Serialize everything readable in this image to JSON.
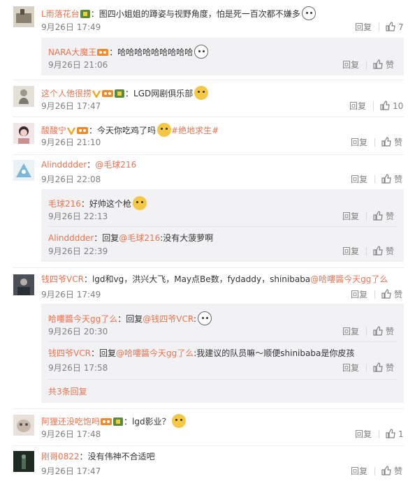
{
  "colors": {
    "link": "#eb7350",
    "meta": "#808080",
    "subbg": "#f2f2f5"
  },
  "actions": {
    "reply": "回复",
    "like": "赞"
  },
  "comments": [
    {
      "user": "L雨落花台",
      "sep": "：",
      "text": "图四小姐姐的蹲姿与视野角度，怕是死一百次都不嫌多",
      "time": "9月26日 17:49",
      "likes": "7",
      "replies": [
        {
          "user": "NARA大魔王",
          "sep": "：",
          "text": "哈哈哈哈哈哈哈哈哈",
          "time": "9月26日 21:06"
        }
      ]
    },
    {
      "user": "这个人他很捞",
      "sep": "：",
      "text": "LGD网剧俱乐部",
      "time": "9月26日 17:47",
      "likes": "10"
    },
    {
      "user": "酸酸宁",
      "sep": "：",
      "text": "今天你吃鸡了吗",
      "tag": "#绝地求生#",
      "time": "9月26日 21:10"
    },
    {
      "user": "Alindddder",
      "sep": "：",
      "mention": "@毛球216",
      "time": "9月26日 22:08",
      "replies": [
        {
          "user": "毛球216",
          "sep": "：",
          "text": "好帅这个枪",
          "time": "9月26日 22:13"
        },
        {
          "user": "Alindddder",
          "sep": "：",
          "prefix": "回复",
          "mention": "@毛球216",
          "text": ":没有大菠萝啊",
          "time": "9月26日 22:39"
        }
      ]
    },
    {
      "user": "钱四爷VCR",
      "sep": "：",
      "text": "lgd和vg，洪兴大飞，May点Be数，fydaddy，shinibaba",
      "mention": "@哈嘍醬今天gg了么",
      "time": "9月26日 17:49",
      "replies": [
        {
          "user": "哈嘍醬今天gg了么",
          "sep": "：",
          "prefix": "回复",
          "mention": "@钱四爷VCR",
          "text": ":",
          "time": "9月26日 20:30"
        },
        {
          "user": "钱四爷VCR",
          "sep": "：",
          "prefix": "回复",
          "mention": "@哈嘍醬今天gg了么",
          "text": ":我建议的队员嘛～顺便shinibaba是你皮孩",
          "time": "9月26日 17:58"
        }
      ],
      "more": "共3条回复"
    },
    {
      "user": "阿狸还没吃饱吗",
      "sep": "：",
      "text": "lgd影业？",
      "time": "9月26日 17:48",
      "likes": "1"
    },
    {
      "user": "刚哥0822",
      "sep": "：",
      "text": "没有伟神不合适吧",
      "time": "9月26日 17:47"
    }
  ]
}
